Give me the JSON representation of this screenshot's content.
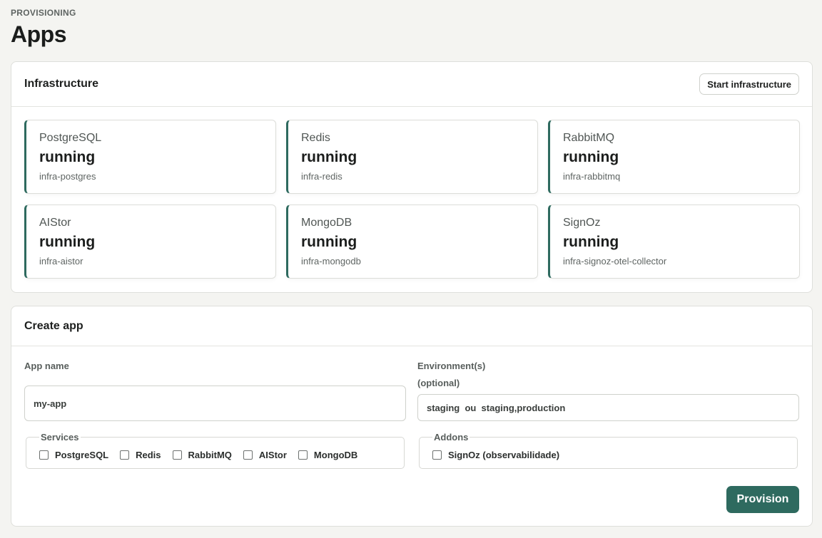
{
  "header": {
    "eyebrow": "PROVISIONING",
    "title": "Apps"
  },
  "infrastructure": {
    "title": "Infrastructure",
    "start_button": "Start infrastructure",
    "services": [
      {
        "name": "PostgreSQL",
        "status": "running",
        "container": "infra-postgres"
      },
      {
        "name": "Redis",
        "status": "running",
        "container": "infra-redis"
      },
      {
        "name": "RabbitMQ",
        "status": "running",
        "container": "infra-rabbitmq"
      },
      {
        "name": "AIStor",
        "status": "running",
        "container": "infra-aistor"
      },
      {
        "name": "MongoDB",
        "status": "running",
        "container": "infra-mongodb"
      },
      {
        "name": "SignOz",
        "status": "running",
        "container": "infra-signoz-otel-collector"
      }
    ]
  },
  "create_app": {
    "title": "Create app",
    "app_name_label": "App name",
    "app_name_placeholder": "my-app",
    "env_label": "Environment(s)",
    "env_optional": "(optional)",
    "env_placeholder": "staging  ou  staging,production",
    "services_legend": "Services",
    "services": [
      "PostgreSQL",
      "Redis",
      "RabbitMQ",
      "AIStor",
      "MongoDB"
    ],
    "addons_legend": "Addons",
    "addons": [
      "SignOz (observabilidade)"
    ],
    "provision_button": "Provision"
  },
  "colors": {
    "accent": "#2e6a5f",
    "background": "#f4f4f1"
  }
}
